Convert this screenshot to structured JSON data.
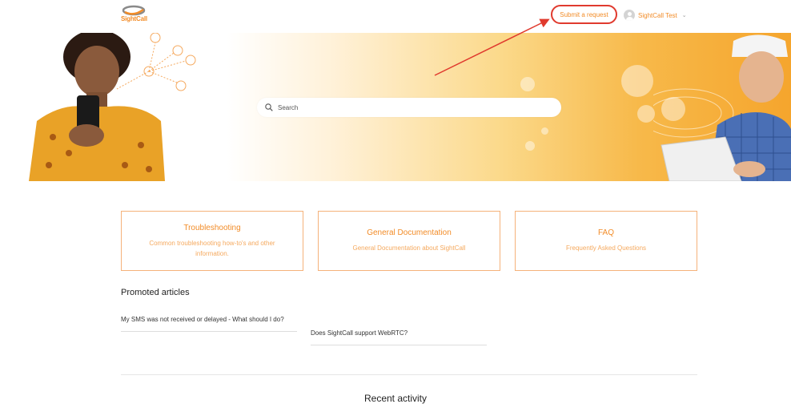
{
  "brand": {
    "logo_text": "SightCall",
    "accent": "#f28c28",
    "annotation_red": "#e03a2e"
  },
  "header": {
    "submit_label": "Submit a request",
    "user_name": "SightCall Test"
  },
  "hero": {
    "search_placeholder": "Search"
  },
  "categories": [
    {
      "title": "Troubleshooting",
      "description": "Common troubleshooting how-to's and other information."
    },
    {
      "title": "General Documentation",
      "description": "General Documentation about SightCall"
    },
    {
      "title": "FAQ",
      "description": "Frequently Asked Questions"
    }
  ],
  "promoted": {
    "title": "Promoted articles",
    "articles": [
      {
        "title": "My SMS was not received or delayed - What should I do?"
      },
      {
        "title": "Does SightCall support WebRTC?"
      }
    ]
  },
  "recent": {
    "title": "Recent activity"
  }
}
